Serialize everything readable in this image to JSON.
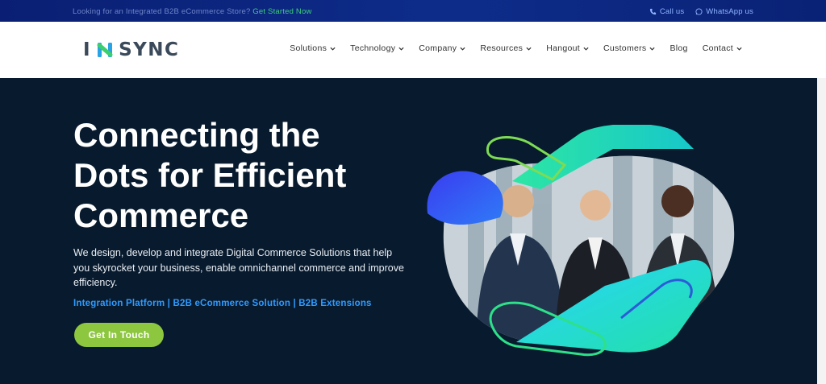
{
  "topbar": {
    "promo_text": "Looking for an Integrated B2B eCommerce Store?",
    "promo_cta": "Get Started Now",
    "call_label": "Call us",
    "whatsapp_label": "WhatsApp us"
  },
  "header": {
    "logo_left": "I",
    "logo_right": "SYNC",
    "nav": [
      {
        "label": "Solutions"
      },
      {
        "label": "Technology"
      },
      {
        "label": "Company"
      },
      {
        "label": "Resources"
      },
      {
        "label": "Hangout"
      },
      {
        "label": "Customers"
      },
      {
        "label": "Blog"
      },
      {
        "label": "Contact"
      }
    ]
  },
  "hero": {
    "headline_line1": "Connecting the",
    "headline_line2": "Dots for Efficient",
    "headline_line3": "Commerce",
    "description": "We design, develop and integrate Digital Commerce Solutions that help you skyrocket your business, enable omnichannel commerce and improve efficiency.",
    "links": "Integration Platform | B2B eCommerce Solution | B2B Extensions",
    "cta_label": "Get In Touch"
  },
  "colors": {
    "topbar_bg": "#0d2c8a",
    "hero_bg": "#081a2d",
    "accent_green": "#8dc63f",
    "link_blue": "#2f9bff",
    "promo_green": "#3ed07a"
  }
}
